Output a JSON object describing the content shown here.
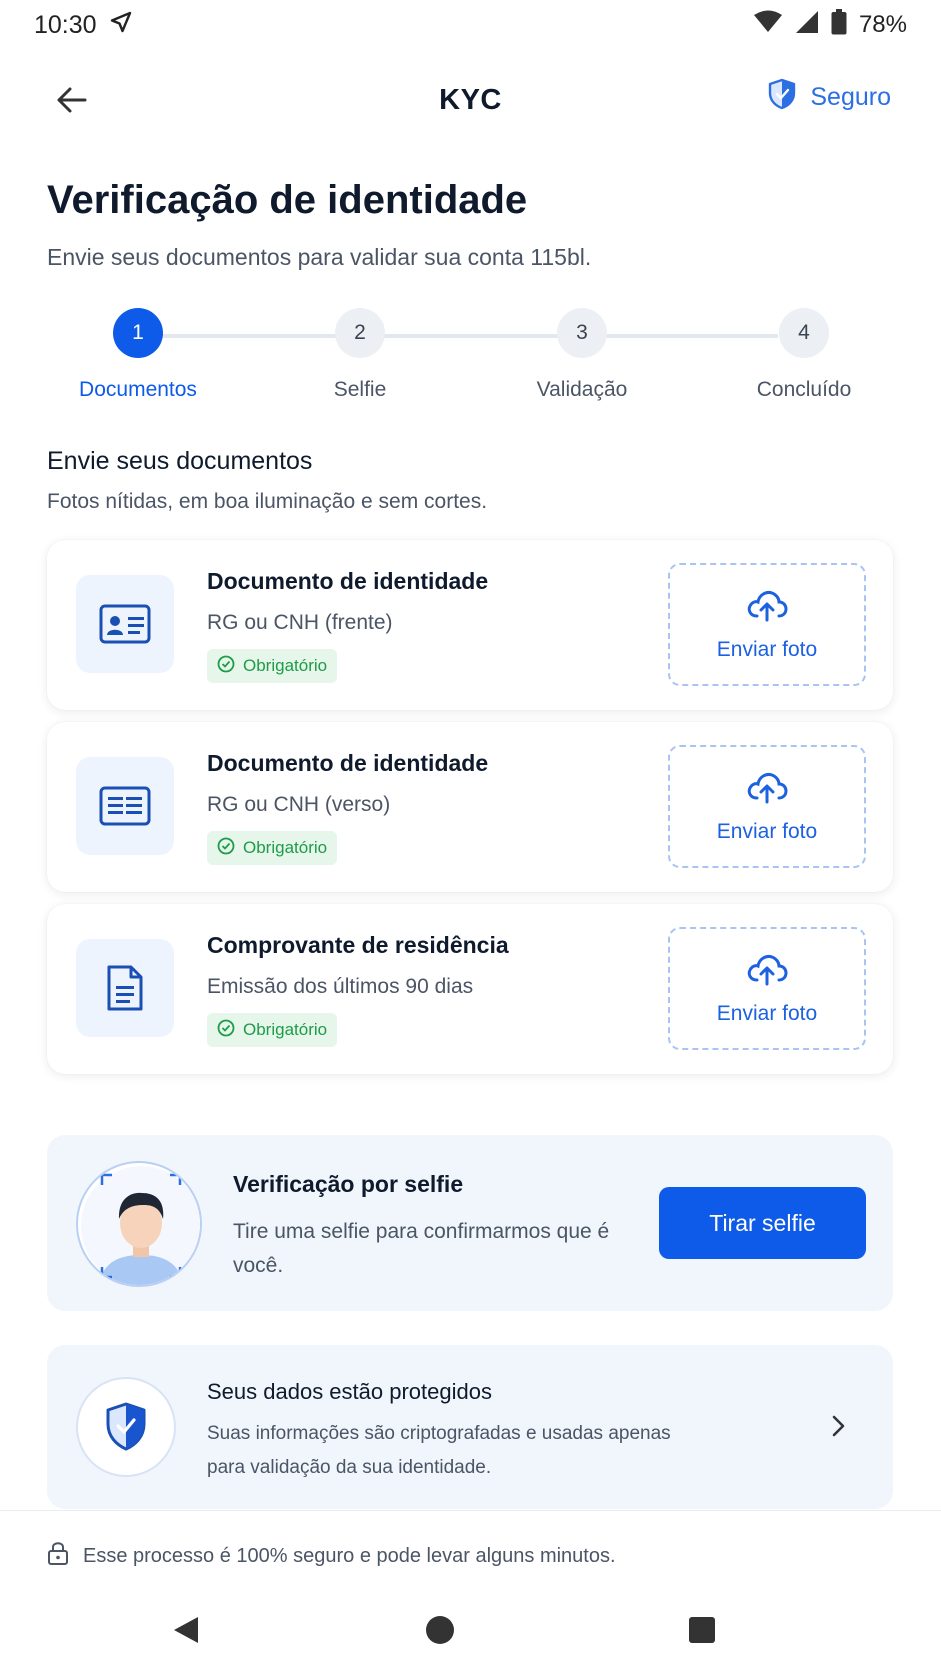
{
  "status_bar": {
    "time": "10:30",
    "battery": "78%"
  },
  "app_bar": {
    "title": "KYC",
    "secure_label": "Seguro"
  },
  "page": {
    "title": "Verificação de identidade",
    "subtitle": "Envie seus documentos para validar sua conta 115bl."
  },
  "stepper": {
    "steps": [
      {
        "number": "1",
        "label": "Documentos",
        "active": true
      },
      {
        "number": "2",
        "label": "Selfie",
        "active": false
      },
      {
        "number": "3",
        "label": "Validação",
        "active": false
      },
      {
        "number": "4",
        "label": "Concluído",
        "active": false
      }
    ]
  },
  "documents_section": {
    "title": "Envie seus documentos",
    "subtitle": "Fotos nítidas, em boa iluminação e sem cortes.",
    "items": [
      {
        "icon": "id-card-icon",
        "title": "Documento de identidade",
        "description": "RG ou CNH (frente)",
        "badge": "Obrigatório",
        "upload_label": "Enviar foto"
      },
      {
        "icon": "id-card-back-icon",
        "title": "Documento de identidade",
        "description": "RG ou CNH (verso)",
        "badge": "Obrigatório",
        "upload_label": "Enviar foto"
      },
      {
        "icon": "document-icon",
        "title": "Comprovante de residência",
        "description": "Emissão dos últimos 90 dias",
        "badge": "Obrigatório",
        "upload_label": "Enviar foto"
      }
    ]
  },
  "selfie": {
    "title": "Verificação por selfie",
    "description": "Tire uma selfie para confirmarmos que é você.",
    "button_label": "Tirar selfie"
  },
  "protection": {
    "title": "Seus dados estão protegidos",
    "description": "Suas informações são criptografadas e usadas apenas para validação da sua identidade."
  },
  "footer": {
    "text": "Esse processo é 100% seguro e pode levar alguns minutos."
  },
  "colors": {
    "primary": "#0d5be8",
    "success": "#1e9c47",
    "muted": "#4b5565"
  }
}
